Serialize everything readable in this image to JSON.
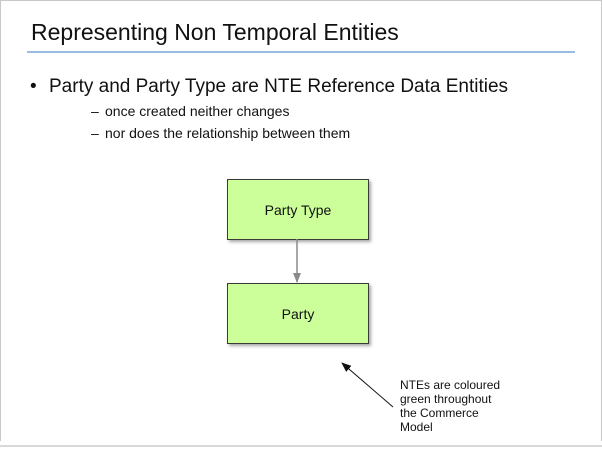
{
  "slide": {
    "title": "Representing Non Temporal Entities",
    "bullet": {
      "mark": "•",
      "text": "Party and Party Type are NTE Reference Data Entities"
    },
    "sub_bullets": [
      {
        "dash": "–",
        "text": "once created neither changes"
      },
      {
        "dash": "–",
        "text": "nor does the relationship between them"
      }
    ]
  },
  "diagram": {
    "nodes": [
      {
        "label": "Party Type",
        "fill": "#ccff99"
      },
      {
        "label": "Party",
        "fill": "#ccff99"
      }
    ],
    "connector": {
      "from": "Party Type",
      "to": "Party",
      "color": "#888888"
    }
  },
  "callout": {
    "text_lines": [
      "NTEs are coloured",
      "green throughout",
      "the Commerce",
      "Model"
    ]
  },
  "colors": {
    "title_rule": "#9bbbe0",
    "nte_green": "#ccff99"
  }
}
